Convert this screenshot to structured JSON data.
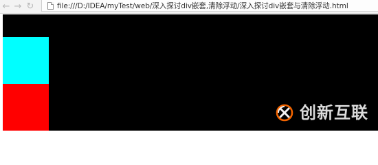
{
  "browser": {
    "address_bar": {
      "url": "file:///D:/IDEA/myTest/web/深入探讨div嵌套,清除浮动/深入探讨div嵌套与清除浮动.html"
    },
    "icons": {
      "back": "arrow-left-icon",
      "forward": "arrow-right-icon",
      "reload": "reload-icon",
      "page": "page-icon"
    },
    "glyphs": {
      "back": "←",
      "forward": "→",
      "reload": "↻"
    }
  },
  "watermark": {
    "brand_text": "创新互联"
  },
  "colors": {
    "viewport_background": "#000000",
    "cyan_box": "#00ffff",
    "red_box": "#ff0000",
    "logo_orange": "#ff6a00",
    "watermark_gray": "#d9d9d9"
  }
}
